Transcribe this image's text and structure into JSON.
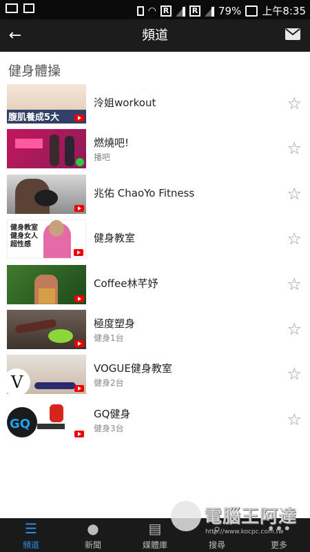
{
  "status": {
    "battery": "79%",
    "time": "上午8:35",
    "sim1": "R",
    "sim2": "R",
    "sim1_badge": "1",
    "sim2_badge": "2"
  },
  "header": {
    "title": "頻道",
    "back_icon": "arrow-back-icon",
    "mail_icon": "mail-icon"
  },
  "section_title": "健身體操",
  "channels": [
    {
      "name": "泠姐workout",
      "sub": "",
      "thumb_text": "腹肌養成5大"
    },
    {
      "name": "燃燒吧!",
      "sub": "播吧",
      "thumb_text": ""
    },
    {
      "name": "兆佑 ChaoYo Fitness",
      "sub": "",
      "thumb_text": ""
    },
    {
      "name": "健身教室",
      "sub": "",
      "thumb_text": "健身教室 健身女人 超性感"
    },
    {
      "name": "Coffee林芊妤",
      "sub": "",
      "thumb_text": ""
    },
    {
      "name": "極度塑身",
      "sub": "健身1台",
      "thumb_text": ""
    },
    {
      "name": "VOGUE健身教室",
      "sub": "健身2台",
      "thumb_text": "V"
    },
    {
      "name": "GQ健身",
      "sub": "健身3台",
      "thumb_text": "GQ"
    }
  ],
  "tabs": [
    {
      "label": "頻道",
      "icon": "list-icon",
      "active": true
    },
    {
      "label": "新聞",
      "icon": "globe-icon",
      "active": false
    },
    {
      "label": "媒體庫",
      "icon": "library-icon",
      "active": false
    },
    {
      "label": "搜尋",
      "icon": "search-icon",
      "active": false
    },
    {
      "label": "更多",
      "icon": "more-icon",
      "active": false
    }
  ],
  "watermark": {
    "text": "電腦王阿達",
    "url": "http://www.kocpc.com.tw"
  },
  "colors": {
    "accent": "#2f8fe8",
    "appbar": "#1c1c1c",
    "bottombar": "#1a1a1a"
  }
}
